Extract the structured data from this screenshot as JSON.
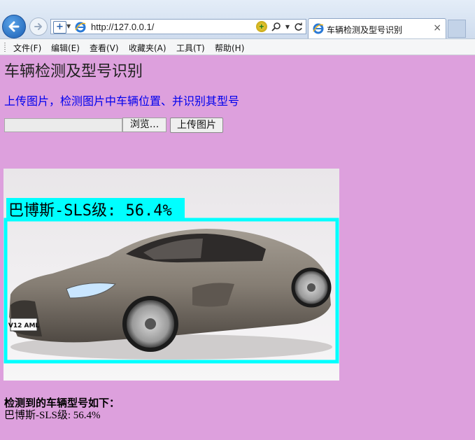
{
  "browser": {
    "url": "http://127.0.0.1/",
    "tab_title": "车辆检测及型号识别",
    "close_glyph": "×",
    "menu": [
      "文件(F)",
      "编辑(E)",
      "查看(V)",
      "收藏夹(A)",
      "工具(T)",
      "帮助(H)"
    ]
  },
  "page": {
    "heading": "车辆检测及型号识别",
    "subtitle": "上传图片，检测图片中车辆位置、并识别其型号",
    "browse_label": "浏览...",
    "upload_label": "上传图片",
    "detection_label": "巴博斯-SLS级: 56.4%",
    "plate_text": "V12 AML",
    "result_heading": "检测到的车辆型号如下：",
    "result_text": "巴博斯-SLS级: 56.4%"
  },
  "colors": {
    "page_background": "#dda0dd",
    "bbox": "#00ffff",
    "subtitle": "#0000ee"
  },
  "icons": [
    "back-arrow-icon",
    "forward-arrow-icon",
    "compat-view-icon",
    "ie-logo-icon",
    "refresh-icon",
    "search-icon",
    "close-icon"
  ]
}
